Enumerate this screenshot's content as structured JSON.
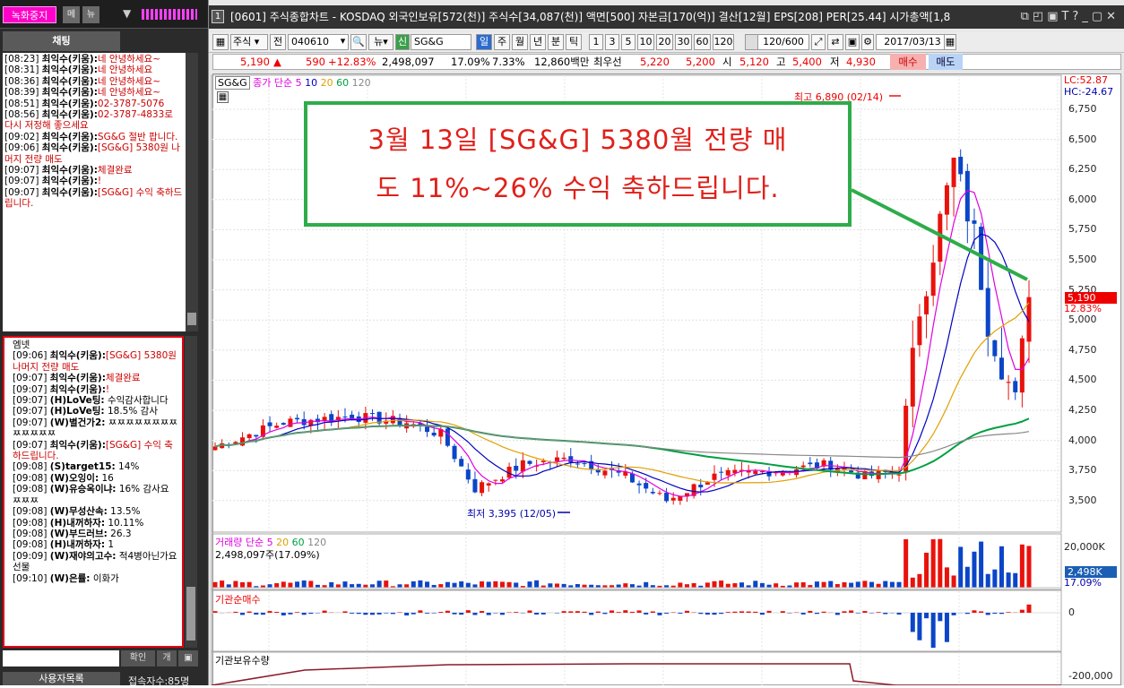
{
  "left_panel": {
    "record_stop": "녹화중지",
    "btn_menu": "메",
    "btn_news": "뉴",
    "chat_tab": "채팅",
    "confirm": "확인",
    "small1": "개",
    "small2": "",
    "user_list": "사용자목록",
    "connected": "접속자수:85명",
    "chat_top": [
      {
        "time": "[08:23]",
        "user": "최익수(키움):",
        "text": "네 안녕하세요~"
      },
      {
        "time": "[08:31]",
        "user": "최익수(키움):",
        "text": "네 안녕하세요"
      },
      {
        "time": "[08:36]",
        "user": "최익수(키움):",
        "text": "네 안녕하세요~"
      },
      {
        "time": "[08:39]",
        "user": "최익수(키움):",
        "text": "네 안녕하세요~"
      },
      {
        "time": "[08:51]",
        "user": "최익수(키움):",
        "text": "02-3787-5076"
      },
      {
        "time": "[08:56]",
        "user": "최익수(키움):",
        "text": "02-3787-4833로 다시 저정해 좋으세요"
      },
      {
        "time": "[09:02]",
        "user": "최익수(키움):",
        "text": "SG&G 절반 팝니다."
      },
      {
        "time": "[09:06]",
        "user": "최익수(키움):",
        "text": "[SG&G] 5380원 나머지 전량 매도"
      },
      {
        "time": "[09:07]",
        "user": "최익수(키움):",
        "text": "체결완료"
      },
      {
        "time": "[09:07]",
        "user": "최익수(키움):",
        "text": "!"
      },
      {
        "time": "[09:07]",
        "user": "최익수(키움):",
        "text": "[SG&G] 수익 축하드립니다."
      }
    ],
    "chat_bottom_header": "엠넷",
    "chat_bottom": [
      {
        "time": "[09:06]",
        "user": "최익수(키움):",
        "text": "[SG&G] 5380원 나머지 전량 매도",
        "red": true
      },
      {
        "time": "[09:07]",
        "user": "최익수(키움):",
        "text": "체결완료",
        "red": true
      },
      {
        "time": "[09:07]",
        "user": "최익수(키움):",
        "text": "!",
        "red": true
      },
      {
        "time": "[09:07]",
        "user": "(H)LoVe팅:",
        "text": " 수익감사합니다",
        "red": false
      },
      {
        "time": "[09:07]",
        "user": "(H)LoVe팅:",
        "text": " 18.5% 감사",
        "red": false
      },
      {
        "time": "[09:07]",
        "user": "(W)별건가2:",
        "text": " ㅉㅉㅉㅉㅉㅉㅉㅉㅉㅉㅉㅉㅉ",
        "red": false
      },
      {
        "time": "[09:07]",
        "user": "최익수(키움):",
        "text": "[SG&G] 수익 축하드립니다.",
        "red": true
      },
      {
        "time": "[09:08]",
        "user": "(S)target15:",
        "text": " 14%",
        "red": false
      },
      {
        "time": "[09:08]",
        "user": "(W)오잉이:",
        "text": " 16",
        "red": false
      },
      {
        "time": "[09:08]",
        "user": "(W)유승옥이냐:",
        "text": " 16% 감사요 ㅉㅉㅉ",
        "red": false
      },
      {
        "time": "[09:08]",
        "user": "(W)무성산속:",
        "text": " 13.5%",
        "red": false
      },
      {
        "time": "[09:08]",
        "user": "(H)내꺼하자:",
        "text": " 10.11%",
        "red": false
      },
      {
        "time": "[09:08]",
        "user": "(W)부드러브:",
        "text": " 26.3",
        "red": false
      },
      {
        "time": "[09:08]",
        "user": "(H)내꺼하자:",
        "text": " 1",
        "red": false
      },
      {
        "time": "[09:09]",
        "user": "(W)재야의고수:",
        "text": " 적4병아닌가요 선물",
        "red": false
      },
      {
        "time": "[09:10]",
        "user": "(W)은률:",
        "text": " 이화가",
        "red": false
      }
    ]
  },
  "window": {
    "num": "1",
    "title": "[0601] 주식종합차트 - KOSDAQ 외국인보유[572(천)] 주식수[34,087(천)] 액면[500] 자본금[170(억)] 결산[12월] EPS[208] PER[25.44] 시가총액[1,8"
  },
  "toolbar": {
    "type": "주식",
    "jeon": "전",
    "code": "040610",
    "news": "뉴",
    "sin": "신",
    "name": "SG&G",
    "periods": [
      "일",
      "주",
      "월",
      "년",
      "분",
      "틱"
    ],
    "nums": [
      "1",
      "3",
      "5",
      "10",
      "20",
      "30",
      "60",
      "120"
    ],
    "count": "120/600",
    "date": "2017/03/13"
  },
  "quote": {
    "price": "5,190",
    "arrow": "▲",
    "change": "590",
    "pct": "+12.83%",
    "volume": "2,498,097",
    "r1": "17.09%",
    "r2": "7.33%",
    "amount": "12,860백만",
    "lbl_best": "최우선",
    "ask": "5,220",
    "bid": "5,200",
    "lbl_open": "시",
    "open": "5,120",
    "lbl_high": "고",
    "high": "5,400",
    "lbl_low": "저",
    "low": "4,930",
    "buy": "매수",
    "sell": "매도"
  },
  "chart": {
    "name": "SG&G",
    "legend_price": "종가 단순",
    "ma": [
      "5",
      "10",
      "20",
      "60",
      "120"
    ],
    "ma_colors": [
      "#e000e0",
      "#0000c0",
      "#e0a000",
      "#00a040",
      "#888888"
    ],
    "hi_label": "최고 6,890 (02/14)",
    "lo_label": "최저 3,395 (12/05)",
    "lc": "LC:52.87",
    "hc": "HC:-24.67",
    "price_ticks": [
      "6,750",
      "6,500",
      "6,250",
      "6,000",
      "5,750",
      "5,500",
      "5,250",
      "5,000",
      "4,750",
      "4,500",
      "4,250",
      "4,000",
      "3,750",
      "3,500"
    ],
    "cur_price": "5,190",
    "cur_pct": "12.83%",
    "vol_legend": "거래량 단순",
    "vol_ma": [
      "5",
      "20",
      "60",
      "120"
    ],
    "vol_value": "2,498,097주(17.09%)",
    "vol_tick": "20,000K",
    "vol_tag": "2,498K",
    "vol_pct": "17.09%",
    "inst_legend": "기관순매수",
    "inst_tick": "0",
    "hold_legend": "기관보유수량",
    "hold_tick": "-200,000"
  },
  "annotation": {
    "line1": "3월 13일 [SG&G] 5380월 전량 매",
    "line2": "도 11%~26% 수익 축하드립니다."
  },
  "colors": {
    "up": "#e8120c",
    "down": "#0b45c8",
    "accent_green": "#2eac4a",
    "record": "#ff00c8"
  }
}
